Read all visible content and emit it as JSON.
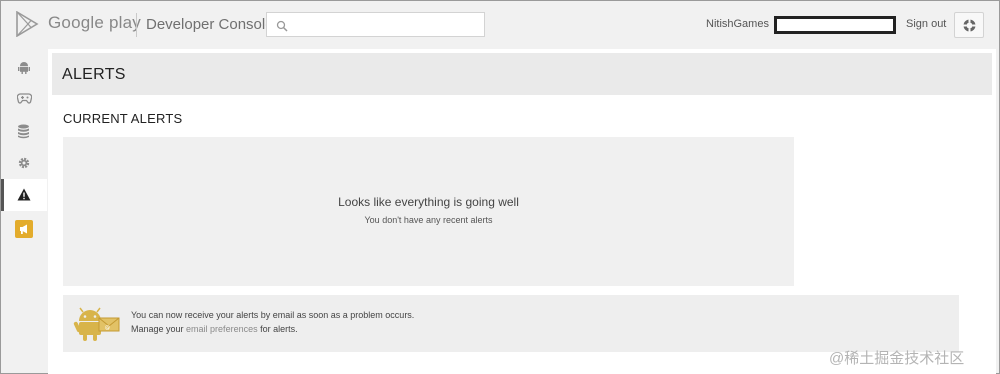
{
  "header": {
    "brand": "Google play",
    "console_title": "Developer Console",
    "search": {
      "value": "",
      "placeholder": ""
    },
    "account_name": "NitishGames",
    "sign_out_label": "Sign out",
    "icons": {
      "logo": "google-play-logo",
      "search": "search-icon",
      "help": "help-icon"
    }
  },
  "sidebar": {
    "items": [
      {
        "name": "all-applications",
        "icon": "android-icon",
        "active": false
      },
      {
        "name": "game-services",
        "icon": "gamepad-icon",
        "active": false
      },
      {
        "name": "reports",
        "icon": "database-icon",
        "active": false
      },
      {
        "name": "settings",
        "icon": "gear-icon",
        "active": false
      },
      {
        "name": "alerts",
        "icon": "warning-icon",
        "active": true
      },
      {
        "name": "announcements",
        "icon": "megaphone-icon",
        "active": false
      }
    ]
  },
  "main": {
    "page_title": "ALERTS",
    "section_title": "CURRENT ALERTS",
    "empty_state": {
      "title": "Looks like everything is going well",
      "subtitle": "You don't have any recent alerts"
    },
    "email_banner": {
      "line1": "You can now receive your alerts by email as soon as a problem occurs.",
      "line2_prefix": "Manage your ",
      "link_text": "email preferences",
      "line2_suffix": " for alerts."
    }
  },
  "watermark": "@稀土掘金技术社区",
  "colors": {
    "header_bg": "#f1f1f1",
    "panel_bg": "#ffffff",
    "panel_header_bg": "#eaeaea",
    "mascot": "#d8b44a",
    "announcement_badge": "#e3ac2c"
  }
}
